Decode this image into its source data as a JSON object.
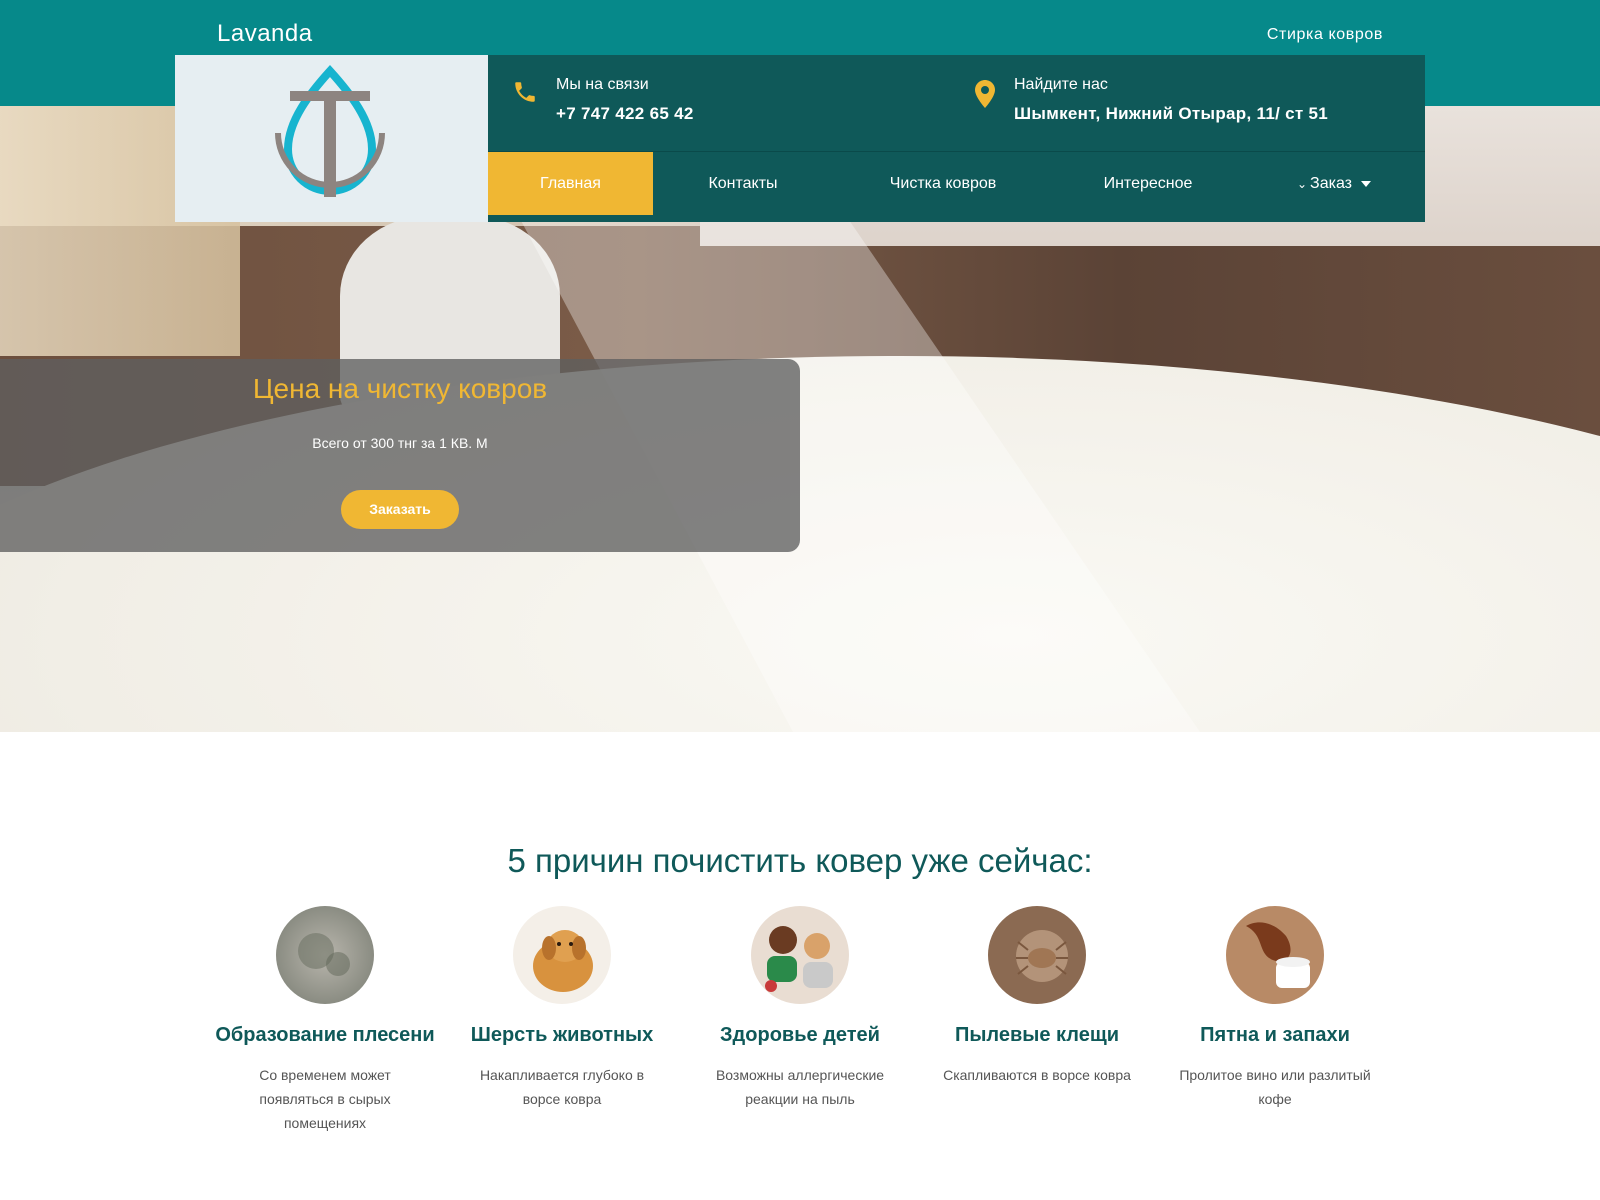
{
  "header": {
    "site_name": "Lavanda",
    "top_link": "Стирка ковров",
    "contact_phone": {
      "label": "Мы на связи",
      "value": "+7 747 422 65 42",
      "icon": "phone-icon"
    },
    "contact_address": {
      "label": "Найдите нас",
      "value": "Шымкент, Нижний Отырар, 11/ ст 51",
      "icon": "map-pin-icon"
    },
    "logo": "lavanda-logo"
  },
  "nav": {
    "items": [
      {
        "label": "Главная",
        "active": true
      },
      {
        "label": "Контакты",
        "active": false
      },
      {
        "label": "Чистка ковров",
        "active": false
      },
      {
        "label": "Интересное",
        "active": false
      },
      {
        "label": "Заказ",
        "active": false,
        "dropdown": true
      }
    ]
  },
  "hero": {
    "title": "Цена на чистку ковров",
    "subtitle": "Всего от 300 тнг за 1 КВ. М",
    "button": "Заказать"
  },
  "reasons": {
    "title": "5 причин почистить ковер уже сейчас:",
    "items": [
      {
        "title": "Образование плесени",
        "text": "Со временем может появляться в сырых помещениях",
        "image": "mold-carpet-image"
      },
      {
        "title": "Шерсть животных",
        "text": "Накапливается глубоко в ворсе ковра",
        "image": "dog-image"
      },
      {
        "title": "Здоровье детей",
        "text": "Возможны аллергические реакции на пыль",
        "image": "children-image"
      },
      {
        "title": "Пылевые клещи",
        "text": "Скапливаются в ворсе ковра",
        "image": "dust-mite-image"
      },
      {
        "title": "Пятна и запахи",
        "text": "Пролитое вино или разлитый кофе",
        "image": "coffee-stain-image"
      }
    ]
  },
  "colors": {
    "teal": "#06898a",
    "dark_teal": "#0f5959",
    "accent": "#f0b733"
  }
}
